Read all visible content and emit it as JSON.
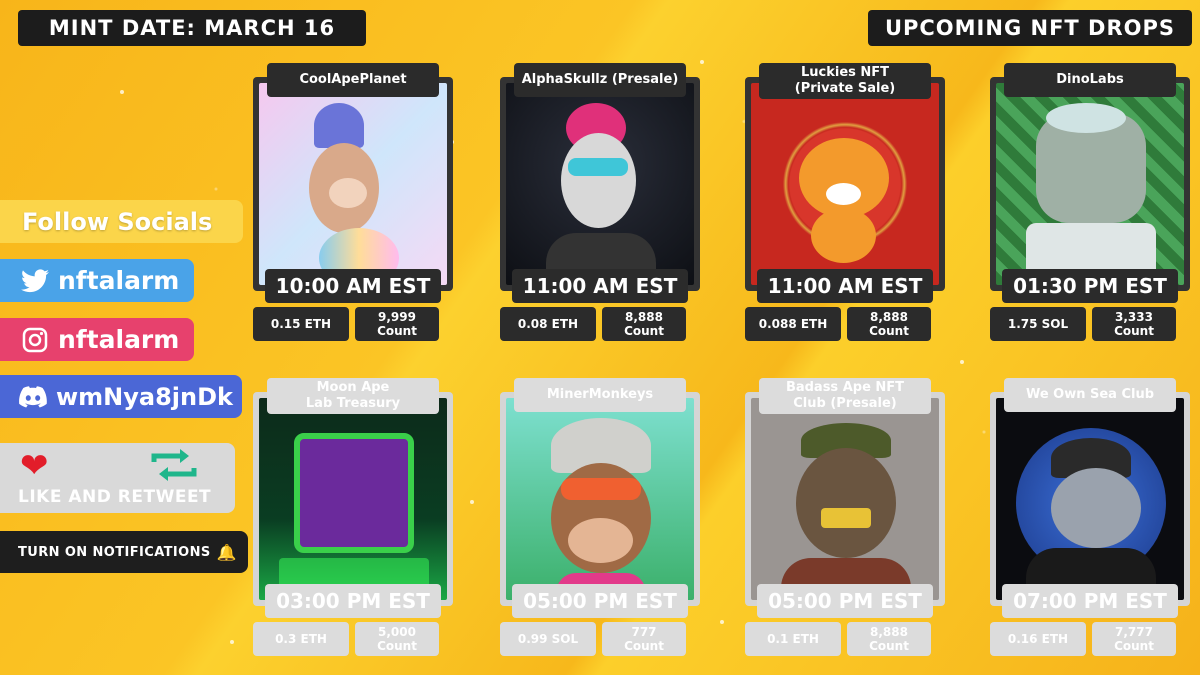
{
  "header": {
    "mint_date": "MINT DATE: MARCH 16",
    "title": "UPCOMING NFT DROPS"
  },
  "sidebar": {
    "follow": "Follow Socials",
    "twitter": "nftalarm",
    "instagram": "nftalarm",
    "discord": "wmNya8jnDk",
    "like_retweet": "LIKE AND RETWEET",
    "notifications": "TURN ON NOTIFICATIONS"
  },
  "colors": {
    "background": "#f8b81b",
    "twitter": "#4aa3e8",
    "instagram": "#e7416d",
    "discord": "#4b67d6",
    "dark_panel": "#2b2b2b",
    "light_panel": "#dcdcdc"
  },
  "drops": [
    {
      "name": "CoolApePlanet",
      "time": "10:00 AM EST",
      "price": "0.15 ETH",
      "count": "9,999\nCount"
    },
    {
      "name": "AlphaSkullz (Presale)",
      "time": "11:00 AM EST",
      "price": "0.08 ETH",
      "count": "8,888\nCount"
    },
    {
      "name": "Luckies NFT\n(Private Sale)",
      "time": "11:00 AM EST",
      "price": "0.088 ETH",
      "count": "8,888\nCount"
    },
    {
      "name": "DinoLabs",
      "time": "01:30 PM EST",
      "price": "1.75 SOL",
      "count": "3,333\nCount"
    },
    {
      "name": "Moon Ape\nLab Treasury",
      "time": "03:00 PM EST",
      "price": "0.3 ETH",
      "count": "5,000\nCount"
    },
    {
      "name": "MinerMonkeys",
      "time": "05:00 PM EST",
      "price": "0.99 SOL",
      "count": "777\nCount"
    },
    {
      "name": "Badass Ape NFT\nClub (Presale)",
      "time": "05:00 PM EST",
      "price": "0.1 ETH",
      "count": "8,888\nCount"
    },
    {
      "name": "We Own Sea Club",
      "time": "07:00 PM EST",
      "price": "0.16 ETH",
      "count": "7,777\nCount"
    }
  ]
}
